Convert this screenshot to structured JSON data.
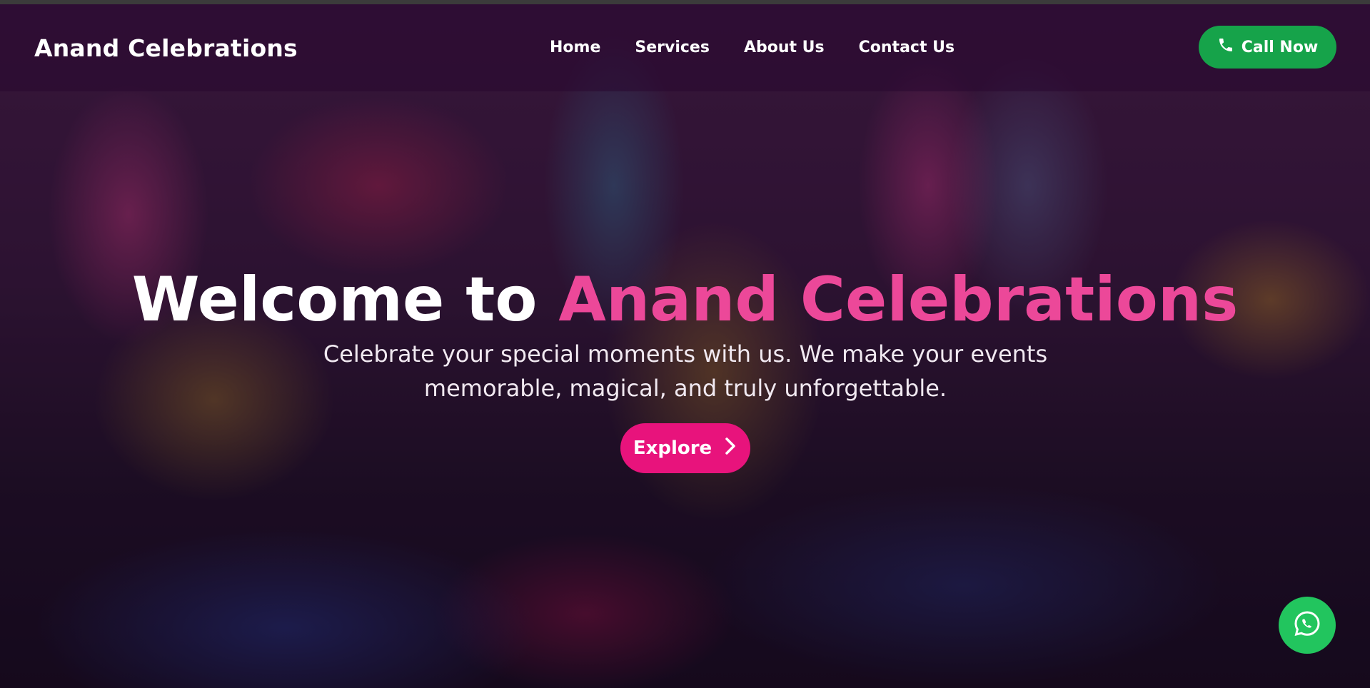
{
  "header": {
    "brand": "Anand Celebrations",
    "nav": [
      {
        "label": "Home"
      },
      {
        "label": "Services"
      },
      {
        "label": "About Us"
      },
      {
        "label": "Contact Us"
      }
    ],
    "call_button": {
      "label": "Call Now",
      "icon": "phone-icon"
    }
  },
  "hero": {
    "headline_prefix": "Welcome to",
    "headline_highlight": "Anand Celebrations",
    "subtitle": "Celebrate your special moments with us. We make your events memorable, magical, and truly unforgettable.",
    "explore_button": {
      "label": "Explore",
      "icon": "chevron-right-icon"
    }
  },
  "floating": {
    "whatsapp_icon": "whatsapp-icon"
  },
  "colors": {
    "accent_pink": "#ec4899",
    "button_pink": "#e8137c",
    "call_green": "#16a34a",
    "whatsapp_green": "#22c55e"
  }
}
